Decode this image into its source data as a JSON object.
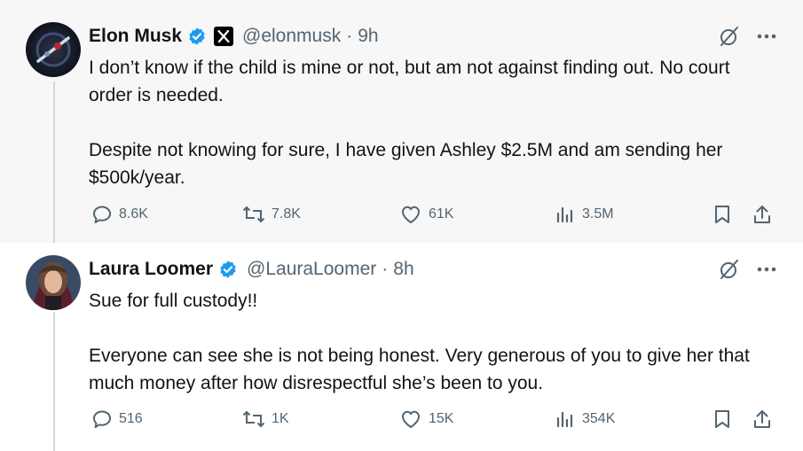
{
  "tweets": [
    {
      "name": "Elon Musk",
      "handle": "@elonmusk",
      "separator": "·",
      "time": "9h",
      "paragraphs": [
        "I don’t know if the child is mine or not, but am not against finding out. No court order is needed.",
        "Despite not knowing for sure, I have given Ashley $2.5M and am sending her $500k/year."
      ],
      "stats": {
        "replies": "8.6K",
        "reposts": "7.8K",
        "likes": "61K",
        "views": "3.5M"
      }
    },
    {
      "name": "Laura Loomer",
      "handle": "@LauraLoomer",
      "separator": "·",
      "time": "8h",
      "paragraphs": [
        "Sue for full custody!!",
        "Everyone can see she is not being honest. Very generous of you to give her that much money after how disrespectful she’s been to you."
      ],
      "stats": {
        "replies": "516",
        "reposts": "1K",
        "likes": "15K",
        "views": "354K"
      }
    }
  ],
  "colors": {
    "verified": "#1d9bf0",
    "muted": "#536471",
    "text": "#0f1419",
    "thread_line": "#cfd9de",
    "bg_highlight": "#f7f7f7"
  },
  "icons": [
    "verified-badge-icon",
    "x-logo-icon",
    "grok-icon",
    "more-icon",
    "reply-icon",
    "repost-icon",
    "like-icon",
    "views-icon",
    "bookmark-icon",
    "share-icon"
  ]
}
